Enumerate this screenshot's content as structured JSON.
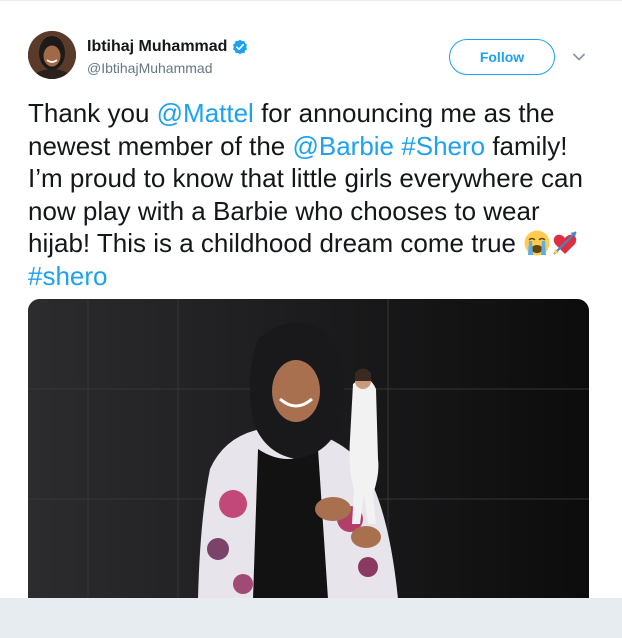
{
  "user": {
    "display_name": "Ibtihaj Muhammad",
    "screen_name": "@IbtihajMuhammad",
    "verified": true
  },
  "actions": {
    "follow_label": "Follow"
  },
  "tweet": {
    "t1": "Thank you ",
    "mention_mattel": "@Mattel",
    "t2": " for announcing me as the newest member of the ",
    "mention_barbie": "@Barbie",
    "t3": " ",
    "hashtag_shero_caps": "#Shero",
    "t4": " family! I’m proud to know that little girls everywhere can now play with a Barbie who chooses to wear hijab! This is a childhood dream come true ",
    "emoji_1": "crying-face-emoji",
    "emoji_2": "heart-with-arrow-emoji",
    "t5": " ",
    "hashtag_shero": "#shero"
  },
  "colors": {
    "link": "#1da1f2",
    "text": "#14171a",
    "secondary": "#657786",
    "background": "#e6ecf0"
  }
}
